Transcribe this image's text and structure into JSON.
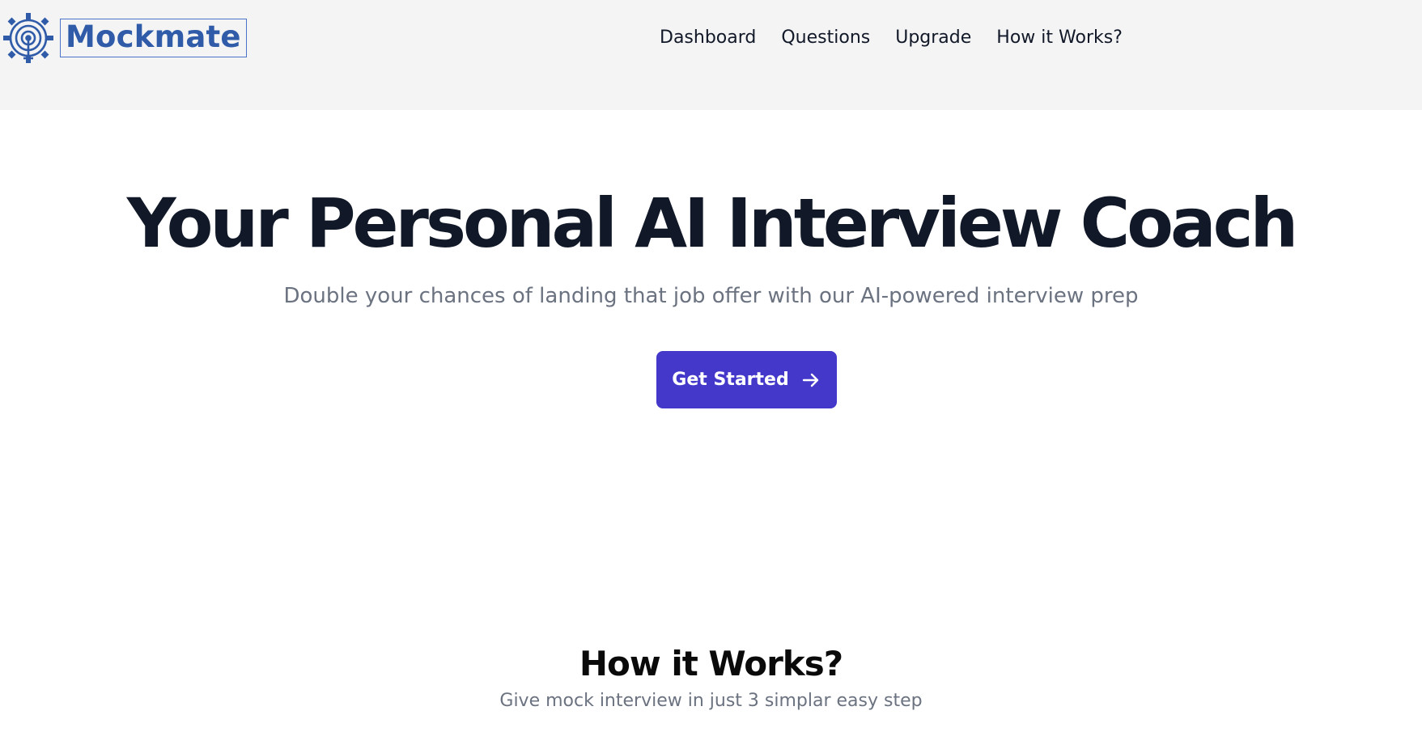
{
  "header": {
    "logo_text": "Mockmate",
    "logo_icon": "gear-target-icon",
    "nav": [
      {
        "label": "Dashboard"
      },
      {
        "label": "Questions"
      },
      {
        "label": "Upgrade"
      },
      {
        "label": "How it Works?"
      }
    ]
  },
  "hero": {
    "title": "Your Personal AI Interview Coach",
    "subtitle": "Double your chances of landing that job offer with our AI-powered interview prep",
    "cta_label": "Get Started",
    "cta_icon": "arrow-right-icon"
  },
  "how_it_works": {
    "title": "How it Works?",
    "subtitle": "Give mock interview in just 3 simplar easy step"
  },
  "colors": {
    "brand": "#2f5ba8",
    "cta": "#4338ca",
    "text": "#111827",
    "muted": "#6b7280",
    "header_bg": "#f4f4f5"
  }
}
